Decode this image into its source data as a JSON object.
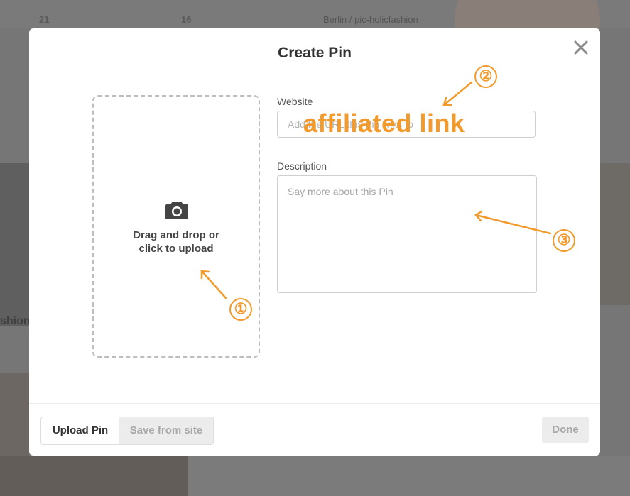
{
  "background": {
    "counts": [
      "21",
      "16"
    ],
    "caption": "Berlin / pic-holicfashion",
    "side_text": "shion"
  },
  "modal": {
    "title": "Create Pin",
    "close_icon": "close-icon"
  },
  "upload": {
    "icon": "camera-icon",
    "line1": "Drag and drop or",
    "line2": "click to upload"
  },
  "form": {
    "website_label": "Website",
    "website_placeholder": "Add the URL this Pin links to",
    "description_label": "Description",
    "description_placeholder": "Say more about this Pin"
  },
  "footer": {
    "tabs": [
      {
        "label": "Upload Pin",
        "active": true
      },
      {
        "label": "Save from site",
        "active": false
      }
    ],
    "done_label": "Done"
  },
  "annotations": {
    "overlay_text": "affiliated link",
    "markers": [
      "①",
      "②",
      "③"
    ],
    "accent_color": "#f39a2d"
  },
  "colors": {
    "backdrop": "#767676",
    "modal_bg": "#ffffff",
    "annotation": "#f39a2d",
    "disabled_button": "#ececec"
  }
}
